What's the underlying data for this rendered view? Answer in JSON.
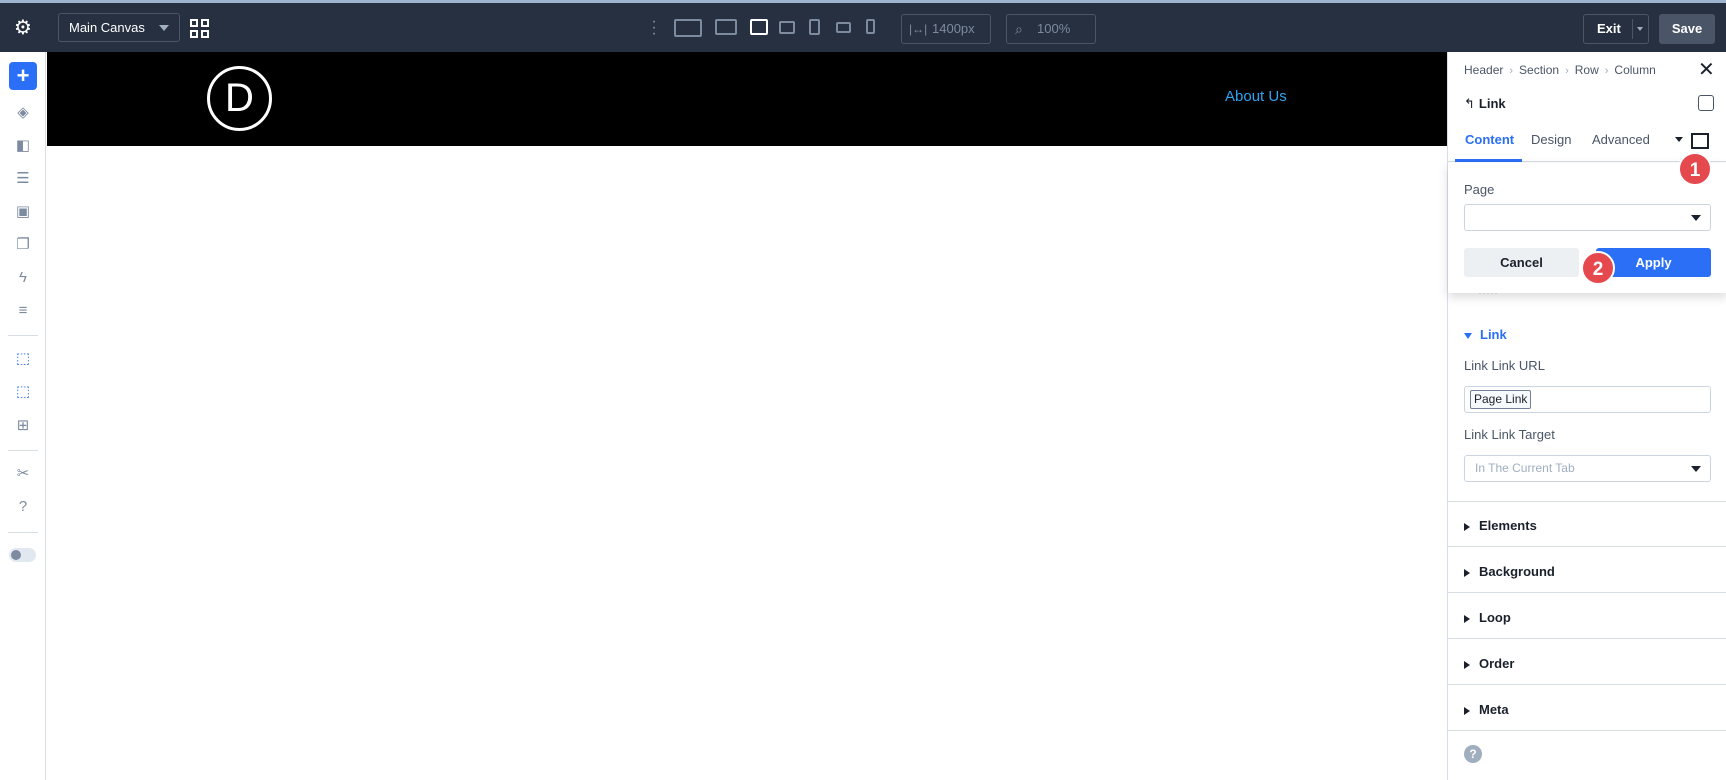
{
  "topbar": {
    "canvas_label": "Main Canvas",
    "width_value": "1400px",
    "zoom_value": "100%",
    "exit_label": "Exit",
    "save_label": "Save"
  },
  "site": {
    "logo_letter": "D",
    "nav_link": "About Us"
  },
  "panel": {
    "breadcrumb": [
      "Header",
      "Section",
      "Row",
      "Column"
    ],
    "module_title": "Link",
    "tabs": [
      "Content",
      "Design",
      "Advanced"
    ],
    "active_tab": "Content",
    "popup": {
      "page_label": "Page",
      "cancel_label": "Cancel",
      "apply_label": "Apply"
    },
    "badges": [
      "1",
      "2"
    ],
    "link_section": {
      "title": "Link",
      "url_label": "Link Link URL",
      "url_chip": "Page Link",
      "target_label": "Link Link Target",
      "target_value": "In The Current Tab"
    },
    "sections": [
      "Elements",
      "Background",
      "Loop",
      "Order",
      "Meta"
    ]
  }
}
